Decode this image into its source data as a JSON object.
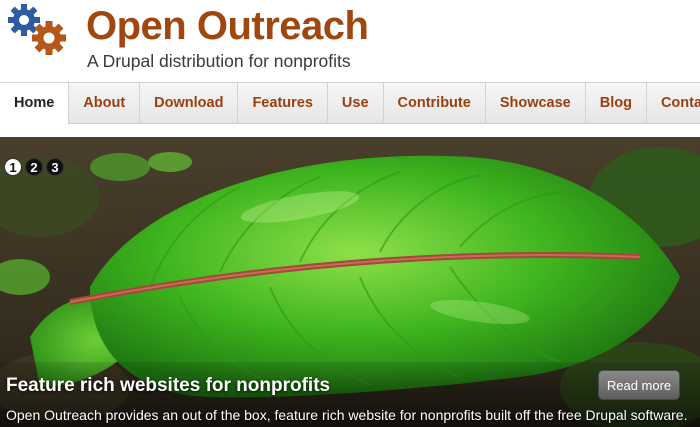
{
  "site": {
    "name": "Open Outreach",
    "slogan": "A Drupal distribution for nonprofits"
  },
  "nav": {
    "items": [
      {
        "label": "Home",
        "active": true
      },
      {
        "label": "About"
      },
      {
        "label": "Download"
      },
      {
        "label": "Features"
      },
      {
        "label": "Use"
      },
      {
        "label": "Contribute"
      },
      {
        "label": "Showcase"
      },
      {
        "label": "Blog"
      },
      {
        "label": "Contact"
      }
    ]
  },
  "slideshow": {
    "pager": [
      "1",
      "2",
      "3"
    ],
    "active_slide": "1",
    "slide": {
      "title": "Feature rich websites for nonprofits",
      "text": "Open Outreach provides an out of the box, feature rich website for nonprofits built off the free Drupal software.",
      "read_more": "Read more"
    }
  },
  "colors": {
    "brand": "#a0460f",
    "gear_blue": "#2d5aa0",
    "gear_orange": "#b5561a",
    "leaf_green": "#3fb51e"
  },
  "icons": {
    "logo": "gears-icon"
  }
}
